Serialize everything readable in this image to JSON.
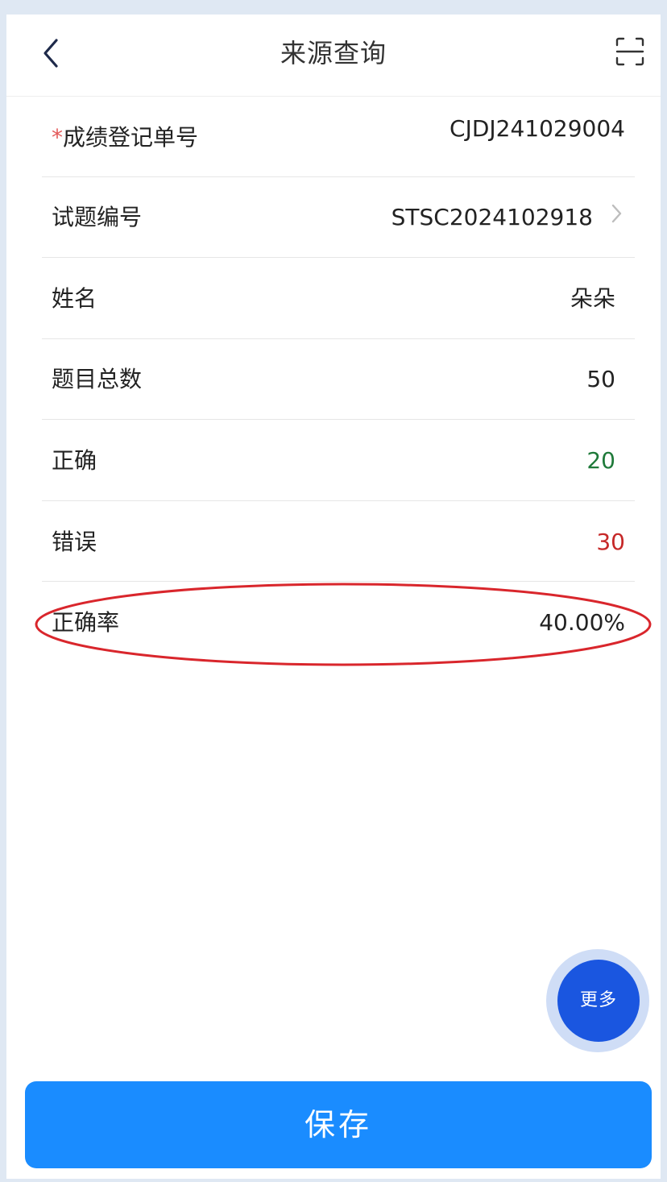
{
  "header": {
    "title": "来源查询",
    "back_icon": "chevron-left-icon",
    "scan_icon": "scan-icon"
  },
  "form": {
    "score_reg_no": {
      "required_mark": "*",
      "label": "成绩登记单号",
      "value": "CJDJ241029004"
    },
    "question_no": {
      "label": "试题编号",
      "value": "STSC2024102918"
    },
    "name": {
      "label": "姓名",
      "value": "朵朵"
    },
    "total_questions": {
      "label": "题目总数",
      "value": "50"
    },
    "correct": {
      "label": "正确",
      "value": "20"
    },
    "wrong": {
      "label": "错误",
      "value": "30"
    },
    "accuracy": {
      "label": "正确率",
      "value": "40.00%"
    }
  },
  "fab": {
    "label": "更多"
  },
  "footer": {
    "save_label": "保存"
  },
  "colors": {
    "correct": "#1f7a3a",
    "wrong": "#c62828",
    "primary": "#1a8cff",
    "fab": "#1a56e0",
    "annotation": "#d9262c"
  }
}
